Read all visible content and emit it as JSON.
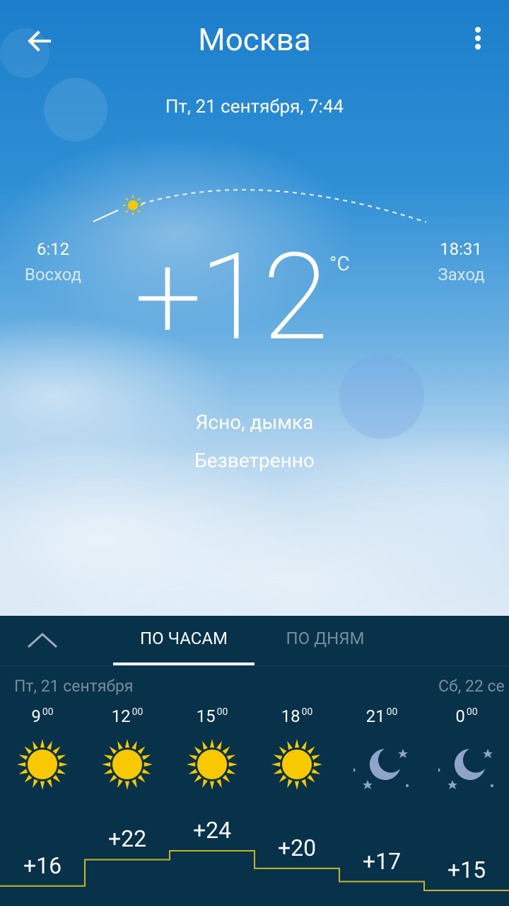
{
  "header": {
    "title": "Москва"
  },
  "date_time": "Пт, 21 сентября, 7:44",
  "sun": {
    "sunrise_time": "6:12",
    "sunrise_label": "Восход",
    "sunset_time": "18:31",
    "sunset_label": "Заход"
  },
  "current": {
    "temperature": "+12",
    "unit": "°C",
    "condition": "Ясно, дымка",
    "wind": "Безветренно"
  },
  "forecast": {
    "tabs": [
      "ПО ЧАСАМ",
      "ПО ДНЯМ"
    ],
    "active_tab": "ПО ЧАСАМ",
    "day_left": "Пт, 21 сентября",
    "day_right": "Сб, 22 се",
    "hours": [
      {
        "hour": "9",
        "minutes": "00",
        "icon": "sun-icon",
        "temp": "+16",
        "value": 16
      },
      {
        "hour": "12",
        "minutes": "00",
        "icon": "sun-icon",
        "temp": "+22",
        "value": 22
      },
      {
        "hour": "15",
        "minutes": "00",
        "icon": "sun-icon",
        "temp": "+24",
        "value": 24
      },
      {
        "hour": "18",
        "minutes": "00",
        "icon": "sun-icon",
        "temp": "+20",
        "value": 20
      },
      {
        "hour": "21",
        "minutes": "00",
        "icon": "moon-stars-icon",
        "temp": "+17",
        "value": 17
      },
      {
        "hour": "0",
        "minutes": "00",
        "icon": "moon-stars-icon",
        "temp": "+15",
        "value": 15
      }
    ]
  },
  "colors": {
    "panel_bg": "#08314a",
    "sun_yellow": "#f8c800",
    "temp_line": "#c8b42a",
    "moon": "#8ea5c9"
  }
}
